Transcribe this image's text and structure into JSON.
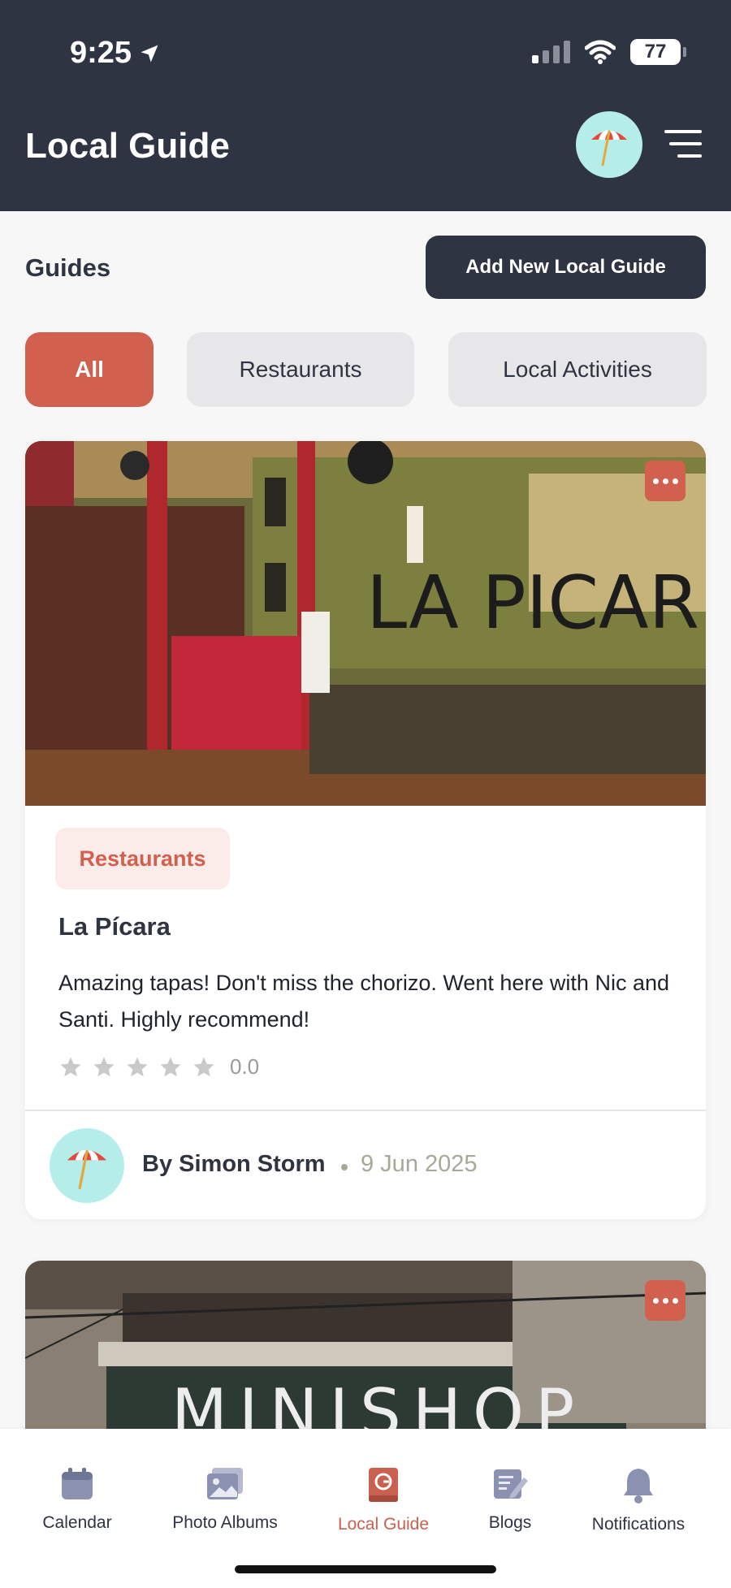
{
  "status": {
    "time": "9:25",
    "battery": "77"
  },
  "header": {
    "title": "Local Guide"
  },
  "section": {
    "title": "Guides",
    "add_button": "Add New Local Guide"
  },
  "filters": [
    {
      "label": "All",
      "active": true
    },
    {
      "label": "Restaurants",
      "active": false
    },
    {
      "label": "Local Activities",
      "active": false
    }
  ],
  "cards": [
    {
      "category": "Restaurants",
      "title": "La Pícara",
      "description": "Amazing tapas! Don't miss the chorizo. Went here with Nic and Santi. Highly recommend!",
      "rating": "0.0",
      "rating_value": 0,
      "author": "By Simon Storm",
      "date": "9 Jun 2025"
    },
    {
      "image_text": "MINISHOP"
    }
  ],
  "tabs": [
    {
      "label": "Calendar",
      "icon": "calendar-icon"
    },
    {
      "label": "Photo Albums",
      "icon": "photo-icon"
    },
    {
      "label": "Local Guide",
      "icon": "guide-icon",
      "active": true
    },
    {
      "label": "Blogs",
      "icon": "blog-icon"
    },
    {
      "label": "Notifications",
      "icon": "bell-icon"
    }
  ],
  "colors": {
    "header_bg": "#2f3442",
    "accent": "#d2604e",
    "avatar_bg": "#b5eee9"
  }
}
